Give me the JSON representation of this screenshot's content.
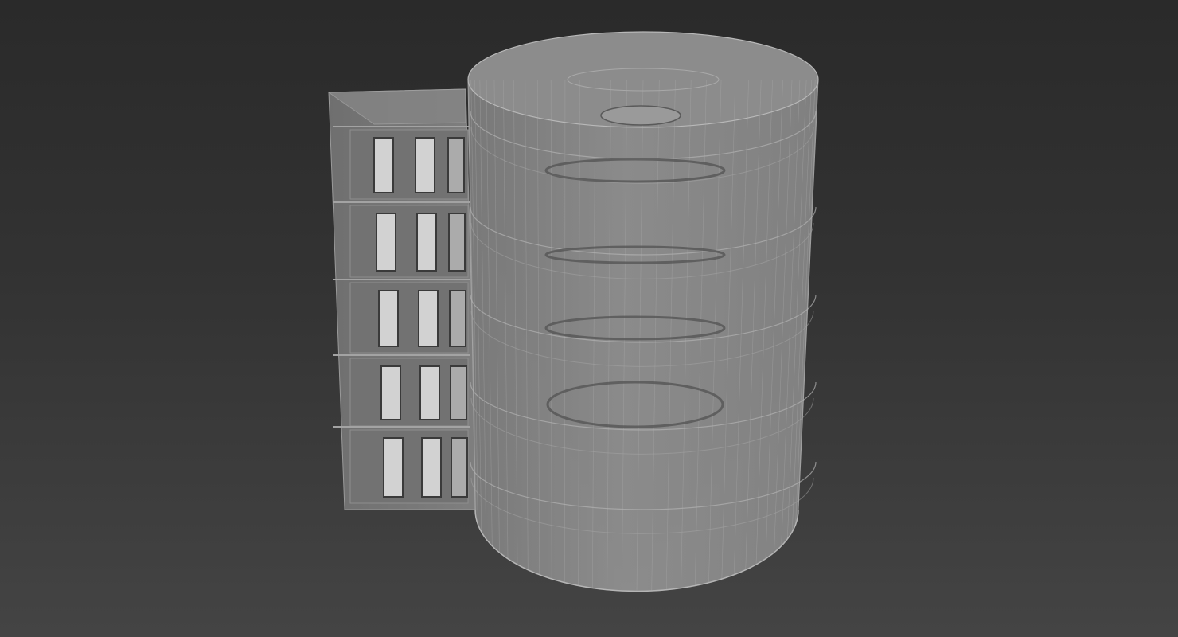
{
  "viewport": {
    "background_top": "#2a2a2a",
    "background_bottom": "#444444"
  },
  "scene": {
    "model": "cylindrical-tower-with-side-block-wireframe",
    "side_block": {
      "floors": 5,
      "doors_per_floor": 3,
      "shell_color": "#7a7a7a",
      "door_color": "#d2d2d2"
    },
    "tower": {
      "floor_rings": 5,
      "floor_openings": 4,
      "shell_color": "#8a8a8a",
      "wire_color": "#b0b0b0"
    }
  }
}
